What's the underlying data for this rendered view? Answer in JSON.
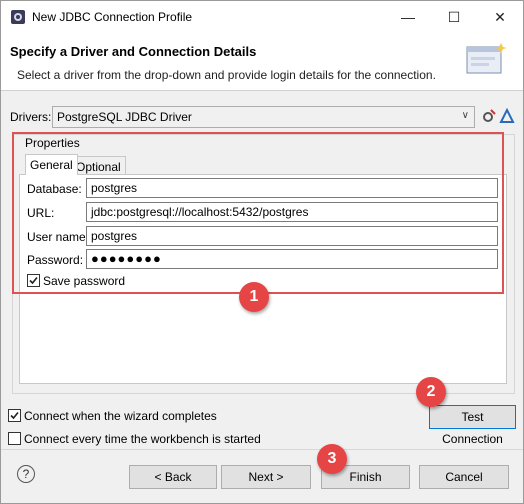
{
  "window": {
    "title": "New JDBC Connection Profile"
  },
  "icons": {
    "app": "eclipse-db-icon",
    "banner": "wizard-banner-icon",
    "edit_driver": "edit-driver-icon",
    "new_driver": "new-driver-icon",
    "help": "help-icon"
  },
  "header": {
    "title": "Specify a Driver and Connection Details",
    "description": "Select a driver from the drop-down and provide login details for the connection."
  },
  "drivers": {
    "label": "Drivers:",
    "selected": "PostgreSQL JDBC Driver"
  },
  "properties": {
    "legend": "Properties",
    "tabs": [
      "General",
      "Optional"
    ],
    "fields": {
      "database": {
        "label": "Database:",
        "value": "postgres"
      },
      "url": {
        "label": "URL:",
        "value": "jdbc:postgresql://localhost:5432/postgres"
      },
      "username": {
        "label": "User name:",
        "value": "postgres"
      },
      "password": {
        "label": "Password:",
        "value": "●●●●●●●●"
      }
    },
    "save_password": {
      "label": "Save password",
      "checked": true
    }
  },
  "options": {
    "connect_wizard": {
      "label": "Connect when the wizard completes",
      "checked": true
    },
    "connect_startup": {
      "label": "Connect every time the workbench is started",
      "checked": false
    }
  },
  "buttons": {
    "test": "Test Connection",
    "help": "?",
    "back": "< Back",
    "next": "Next >",
    "finish": "Finish",
    "cancel": "Cancel"
  },
  "annotations": {
    "step1": "1",
    "step2": "2",
    "step3": "3"
  },
  "colors": {
    "highlight": "#e05252",
    "badge": "#e64545",
    "focus": "#0078d7"
  }
}
